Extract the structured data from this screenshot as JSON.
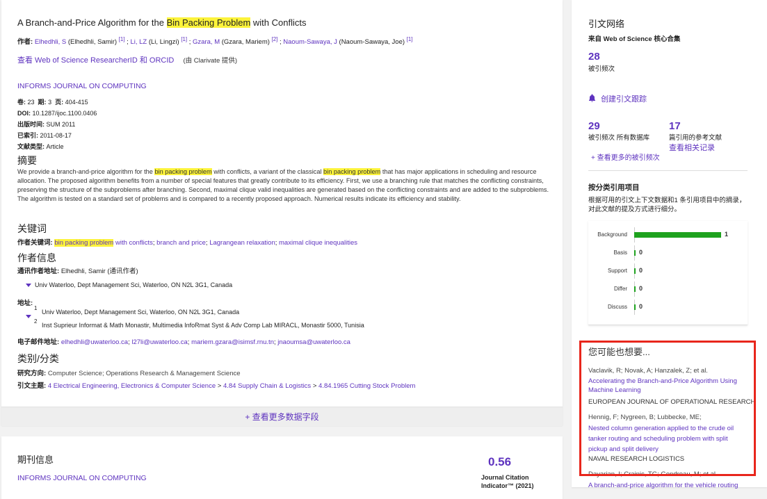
{
  "record": {
    "title_before": "A Branch-and-Price Algorithm for the ",
    "title_highlight": "Bin Packing Problem",
    "title_after": " with Conflicts",
    "authors_label": "作者:",
    "authors": [
      {
        "name": "Elhedhli, S",
        "full": "(Elhedhli, Samir)",
        "ref": "[1]",
        "sep": " ;"
      },
      {
        "name": "Li, LZ",
        "full": "(Li, Lingzi)",
        "ref": "[1]",
        "sep": " ;"
      },
      {
        "name": "Gzara, M",
        "full": "(Gzara, Mariem)",
        "ref": "[2]",
        "sep": " ;"
      },
      {
        "name": "Naoum-Sawaya, J",
        "full": "(Naoum-Sawaya, Joe)",
        "ref": "[1]",
        "sep": ""
      }
    ],
    "researcher_link": "查看 Web of Science ResearcherID 和 ORCID",
    "clarivate_note": "(由 Clarivate 提供)",
    "journal": "INFORMS JOURNAL ON COMPUTING",
    "volume_label": "卷:",
    "volume": "23",
    "issue_label": "期:",
    "issue": "3",
    "pages_label": "页:",
    "pages": "404-415",
    "doi_label": "DOI:",
    "doi": "10.1287/ijoc.1100.0406",
    "published_label": "出版时间:",
    "published": "SUM 2011",
    "indexed_label": "已索引:",
    "indexed": "2011-08-17",
    "doctype_label": "文献类型:",
    "doctype": "Article",
    "abstract_heading": "摘要",
    "abstract_parts": [
      {
        "t": "We provide a branch-and-price algorithm for the ",
        "h": false
      },
      {
        "t": "bin packing problem",
        "h": true
      },
      {
        "t": " with conflicts, a variant of the classical ",
        "h": false
      },
      {
        "t": "bin packing problem",
        "h": true
      },
      {
        "t": " that has major applications in scheduling and resource allocation. The proposed algorithm benefits from a number of special features that greatly contribute to its efficiency. First, we use a branching rule that matches the conflicting constraints, preserving the structure of the subproblems after branching. Second, maximal clique valid inequalities are generated based on the conflicting constraints and are added to the subproblems. The algorithm is tested on a standard set of problems and is compared to a recently proposed approach. Numerical results indicate its efficiency and stability.",
        "h": false
      }
    ],
    "keywords_heading": "关键词",
    "author_keywords_label": "作者关键词:",
    "kw1_highlight": "bin packing problem",
    "kw1_rest": " with conflicts",
    "kw2": "branch and price",
    "kw3": "Lagrangean relaxation",
    "kw4": "maximal clique inequalities",
    "author_info_heading": "作者信息",
    "corresponding_label": "通讯作者地址:",
    "corresponding_name": "Elhedhli, Samir",
    "corresponding_tag": "(通讯作者)",
    "corresponding_addr": "Univ Waterloo, Dept Management Sci, Waterloo, ON N2L 3G1, Canada",
    "addresses_label": "地址:",
    "addr1_num": "1",
    "addr1": "Univ Waterloo, Dept Management Sci, Waterloo, ON N2L 3G1, Canada",
    "addr2_num": "2",
    "addr2": "Inst Suprieur Informat & Math Monastir, Multimedia InfoRmat Syst & Adv Comp Lab MIRACL, Monastir 5000, Tunisia",
    "email_label": "电子邮件地址:",
    "emails": [
      "elhedhli@uwaterloo.ca",
      "l27li@uwaterloo.ca",
      "mariem.gzara@isimsf.rnu.tn",
      "jnaoumsa@uwaterloo.ca"
    ],
    "category_heading": "类别/分类",
    "research_area_label": "研究方向:",
    "research_area": "Computer Science; Operations Research & Management Science",
    "citation_topic_label": "引文主题:",
    "topic1": "4 Electrical Engineering, Electronics & Computer Science",
    "topic2": "4.84 Supply Chain & Logistics",
    "topic3": "4.84.1965 Cutting Stock Problem",
    "topic_sep": ">",
    "see_more": "+ 查看更多数据字段"
  },
  "journal_info": {
    "heading": "期刊信息",
    "name": "INFORMS JOURNAL ON COMPUTING",
    "jci_value": "0.56",
    "jci_label": "Journal Citation",
    "jci_label2": "Indicator™ (2021)"
  },
  "citation_network": {
    "heading": "引文网络",
    "source": "来自 Web of Science 核心合集",
    "times_cited": "28",
    "times_cited_label": "被引频次",
    "create_alert": "创建引文跟踪",
    "all_db_count": "29",
    "all_db_label": "被引频次 所有数据库",
    "refs_count": "17",
    "refs_label": "篇引用的参考文献",
    "related_link": "查看相关记录",
    "more_counts": "+ 查看更多的被引频次",
    "by_category_heading": "按分类引用项目",
    "by_category_desc": "根据可用的引文上下文数据和1 条引用项目中的摘录，对此文献的提及方式进行细分。"
  },
  "chart_data": {
    "type": "bar",
    "orientation": "horizontal",
    "categories": [
      "Background",
      "Basis",
      "Support",
      "Differ",
      "Discuss"
    ],
    "values": [
      1,
      0,
      0,
      0,
      0
    ],
    "xlim": [
      0,
      1
    ],
    "colors": {
      "bar": "#1ea21e"
    }
  },
  "recommendations": {
    "heading": "您可能也想要...",
    "items": [
      {
        "authors": "Vaclavik, R; Novak, A; Hanzalek, Z; et al.",
        "title": "Accelerating the Branch-and-Price Algorithm Using Machine Learning",
        "journal": "EUROPEAN JOURNAL OF OPERATIONAL RESEARCH"
      },
      {
        "authors": "Hennig, F; Nygreen, B; Lubbecke, ME;",
        "title": "Nested column generation applied to the crude oil tanker routing and scheduling problem with split pickup and split delivery",
        "journal": "NAVAL RESEARCH LOGISTICS"
      },
      {
        "authors": "Dayarian, I; Crainic, TG; Gendreau, M; et al.",
        "title": "A branch-and-price algorithm for the vehicle routing",
        "journal": ""
      }
    ]
  },
  "colors": {
    "link": "#5e33bf",
    "highlight": "#fcf33a",
    "annotation": "#e8261c",
    "bar": "#1ea21e"
  }
}
